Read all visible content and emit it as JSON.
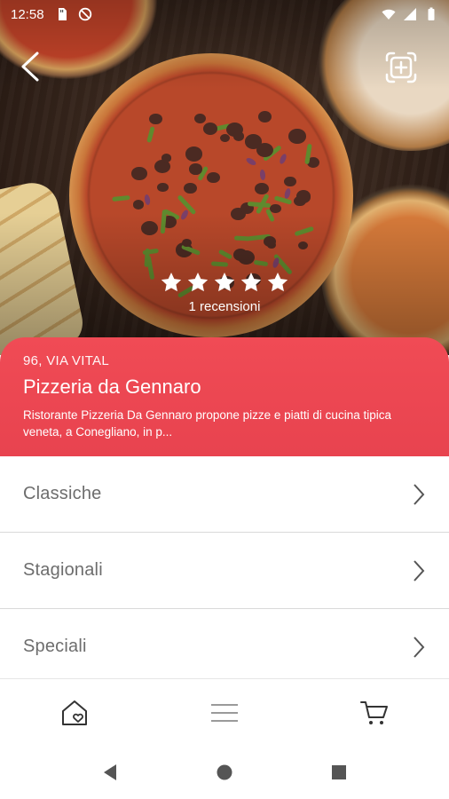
{
  "status_bar": {
    "time": "12:58",
    "icons_left": [
      "sd-card-icon",
      "no-disturb-icon"
    ],
    "icons_right": [
      "wifi-icon",
      "signal-icon",
      "battery-icon"
    ]
  },
  "hero": {
    "rating_stars": 5,
    "reviews_text": "1 recensioni"
  },
  "restaurant": {
    "address": "96, VIA VITAL",
    "name": "Pizzeria da Gennaro",
    "description": "Ristorante Pizzeria Da Gennaro propone pizze e piatti di cucina tipica veneta, a Conegliano, in p..."
  },
  "categories": [
    {
      "label": "Classiche"
    },
    {
      "label": "Stagionali"
    },
    {
      "label": "Speciali"
    }
  ],
  "tabbar": {
    "items": [
      "home-heart-icon",
      "menu-icon",
      "cart-icon"
    ]
  },
  "colors": {
    "accent": "#ee4652",
    "list_text": "#6d6d6d",
    "divider": "#d9d9d9"
  }
}
